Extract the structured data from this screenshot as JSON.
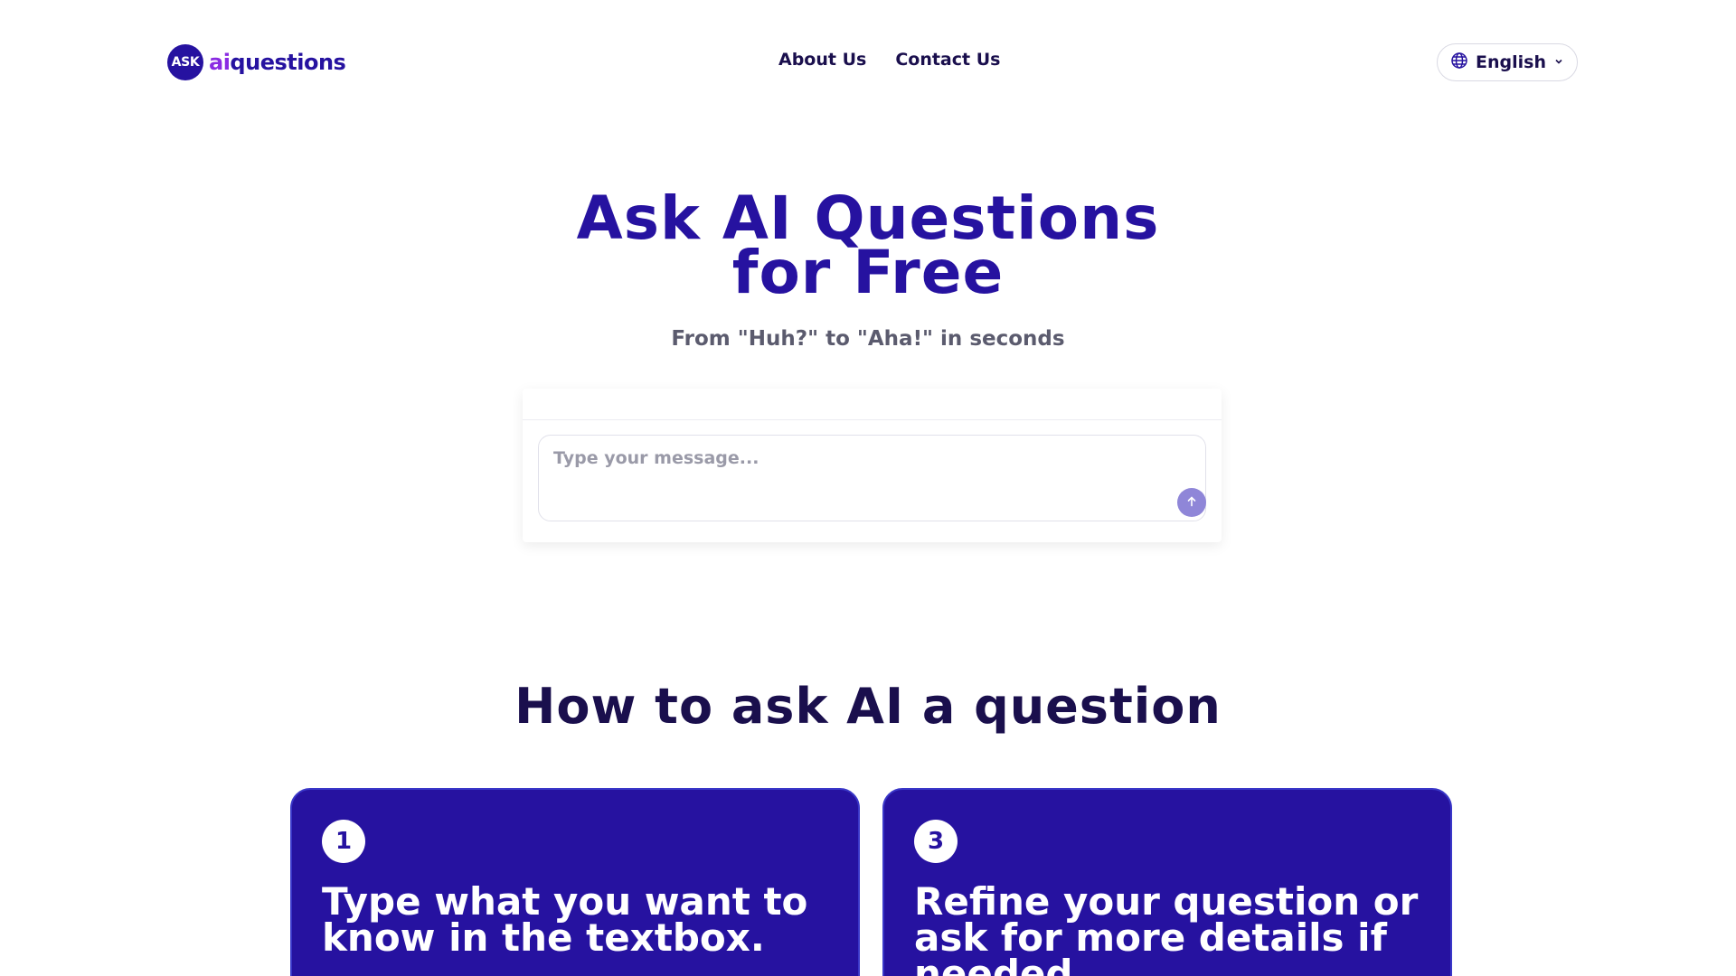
{
  "logo": {
    "badge": "ASK",
    "ai": "ai",
    "questions": "questions"
  },
  "nav": {
    "about": "About Us",
    "contact": "Contact Us"
  },
  "language": {
    "selected": "English"
  },
  "hero": {
    "title_line1": "Ask AI Questions",
    "title_line2": "for Free",
    "subtitle": "From \"Huh?\" to \"Aha!\" in seconds"
  },
  "chat": {
    "placeholder": "Type your message...",
    "value": ""
  },
  "howto": {
    "title": "How to ask AI a question",
    "steps": [
      {
        "number": "1",
        "text": "Type what you want to know in the textbox."
      },
      {
        "number": "3",
        "text": "Refine your question or ask for more details if needed."
      }
    ]
  },
  "colors": {
    "brand": "#2612a0",
    "accent": "#8a2be2",
    "send_button": "#8f86d8",
    "text_dark": "#1a0f4d"
  },
  "icons": {
    "language": "globe-icon",
    "dropdown": "chevron-down-icon",
    "send": "arrow-up-icon"
  }
}
